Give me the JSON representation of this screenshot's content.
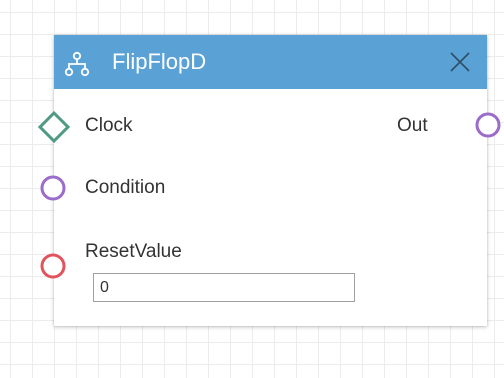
{
  "node": {
    "title": "FlipFlopD",
    "icon": "sitemap-icon",
    "close_icon": "close-icon",
    "header_color": "#5aa2d6"
  },
  "ports": {
    "clock": {
      "label": "Clock",
      "shape": "diamond",
      "color": "#4e9a84"
    },
    "condition": {
      "label": "Condition",
      "shape": "circle",
      "color": "#9b6cc9"
    },
    "reset_value": {
      "label": "ResetValue",
      "shape": "circle",
      "color": "#e2545c",
      "value": "0"
    },
    "out": {
      "label": "Out",
      "shape": "circle",
      "color": "#9b6cc9"
    }
  }
}
